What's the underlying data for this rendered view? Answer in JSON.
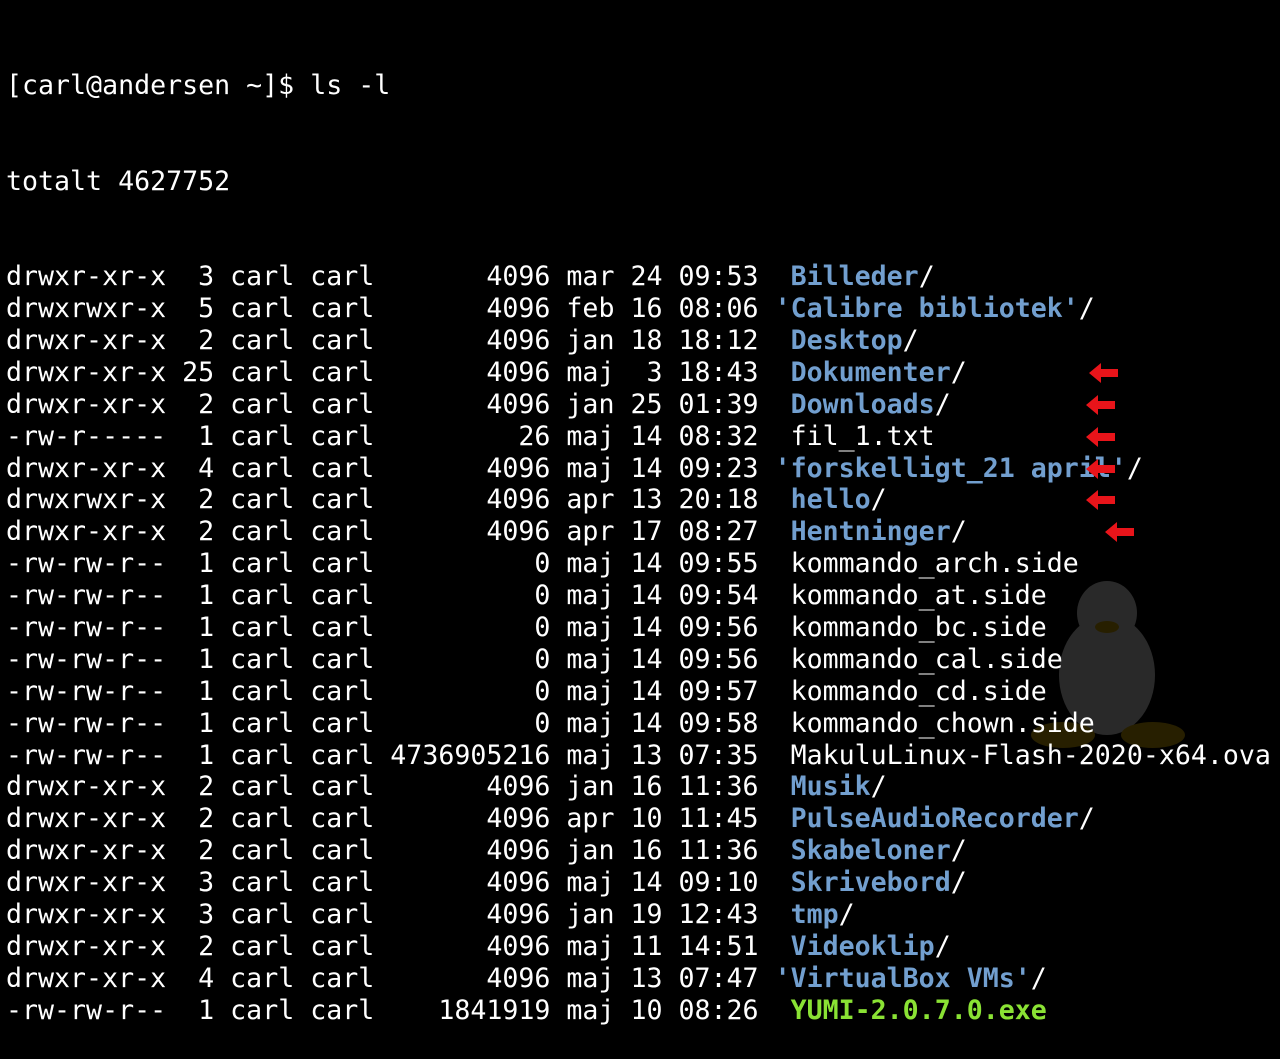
{
  "prompt": "[carl@andersen ~]$ ",
  "command": "ls -l",
  "total": "totalt 4627752",
  "colors": {
    "background": "#000000",
    "text": "#ffffff",
    "directory": "#729fcf",
    "executable": "#8ae234",
    "arrow": "#e8141a"
  },
  "entries": [
    {
      "perm": "drwxr-xr-x",
      "links": " 3",
      "owner": "carl",
      "group": "carl",
      "size": "      4096",
      "month": "mar",
      "day": "24",
      "time": "09:53",
      "lead": " ",
      "name": "Billeder",
      "quoted": false,
      "kind": "dir",
      "suffix": "/",
      "arrow": false
    },
    {
      "perm": "drwxrwxr-x",
      "links": " 5",
      "owner": "carl",
      "group": "carl",
      "size": "      4096",
      "month": "feb",
      "day": "16",
      "time": "08:06",
      "lead": "",
      "name": "Calibre bibliotek",
      "quoted": true,
      "kind": "dir",
      "suffix": "/",
      "arrow": false
    },
    {
      "perm": "drwxr-xr-x",
      "links": " 2",
      "owner": "carl",
      "group": "carl",
      "size": "      4096",
      "month": "jan",
      "day": "18",
      "time": "18:12",
      "lead": " ",
      "name": "Desktop",
      "quoted": false,
      "kind": "dir",
      "suffix": "/",
      "arrow": false
    },
    {
      "perm": "drwxr-xr-x",
      "links": "25",
      "owner": "carl",
      "group": "carl",
      "size": "      4096",
      "month": "maj",
      "day": " 3",
      "time": "18:43",
      "lead": " ",
      "name": "Dokumenter",
      "quoted": false,
      "kind": "dir",
      "suffix": "/",
      "arrow": false
    },
    {
      "perm": "drwxr-xr-x",
      "links": " 2",
      "owner": "carl",
      "group": "carl",
      "size": "      4096",
      "month": "jan",
      "day": "25",
      "time": "01:39",
      "lead": " ",
      "name": "Downloads",
      "quoted": false,
      "kind": "dir",
      "suffix": "/",
      "arrow": false
    },
    {
      "perm": "-rw-r-----",
      "links": " 1",
      "owner": "carl",
      "group": "carl",
      "size": "        26",
      "month": "maj",
      "day": "14",
      "time": "08:32",
      "lead": " ",
      "name": "fil_1.txt",
      "quoted": false,
      "kind": "file",
      "suffix": "",
      "arrow": false
    },
    {
      "perm": "drwxr-xr-x",
      "links": " 4",
      "owner": "carl",
      "group": "carl",
      "size": "      4096",
      "month": "maj",
      "day": "14",
      "time": "09:23",
      "lead": "",
      "name": "forskelligt_21 april",
      "quoted": true,
      "kind": "dir",
      "suffix": "/",
      "arrow": false
    },
    {
      "perm": "drwxrwxr-x",
      "links": " 2",
      "owner": "carl",
      "group": "carl",
      "size": "      4096",
      "month": "apr",
      "day": "13",
      "time": "20:18",
      "lead": " ",
      "name": "hello",
      "quoted": false,
      "kind": "dir",
      "suffix": "/",
      "arrow": false
    },
    {
      "perm": "drwxr-xr-x",
      "links": " 2",
      "owner": "carl",
      "group": "carl",
      "size": "      4096",
      "month": "apr",
      "day": "17",
      "time": "08:27",
      "lead": " ",
      "name": "Hentninger",
      "quoted": false,
      "kind": "dir",
      "suffix": "/",
      "arrow": false
    },
    {
      "perm": "-rw-rw-r--",
      "links": " 1",
      "owner": "carl",
      "group": "carl",
      "size": "         0",
      "month": "maj",
      "day": "14",
      "time": "09:55",
      "lead": " ",
      "name": "kommando_arch.side",
      "quoted": false,
      "kind": "file",
      "suffix": "",
      "arrow": true
    },
    {
      "perm": "-rw-rw-r--",
      "links": " 1",
      "owner": "carl",
      "group": "carl",
      "size": "         0",
      "month": "maj",
      "day": "14",
      "time": "09:54",
      "lead": " ",
      "name": "kommando_at.side",
      "quoted": false,
      "kind": "file",
      "suffix": "",
      "arrow": true
    },
    {
      "perm": "-rw-rw-r--",
      "links": " 1",
      "owner": "carl",
      "group": "carl",
      "size": "         0",
      "month": "maj",
      "day": "14",
      "time": "09:56",
      "lead": " ",
      "name": "kommando_bc.side",
      "quoted": false,
      "kind": "file",
      "suffix": "",
      "arrow": true
    },
    {
      "perm": "-rw-rw-r--",
      "links": " 1",
      "owner": "carl",
      "group": "carl",
      "size": "         0",
      "month": "maj",
      "day": "14",
      "time": "09:56",
      "lead": " ",
      "name": "kommando_cal.side",
      "quoted": false,
      "kind": "file",
      "suffix": "",
      "arrow": true
    },
    {
      "perm": "-rw-rw-r--",
      "links": " 1",
      "owner": "carl",
      "group": "carl",
      "size": "         0",
      "month": "maj",
      "day": "14",
      "time": "09:57",
      "lead": " ",
      "name": "kommando_cd.side",
      "quoted": false,
      "kind": "file",
      "suffix": "",
      "arrow": true
    },
    {
      "perm": "-rw-rw-r--",
      "links": " 1",
      "owner": "carl",
      "group": "carl",
      "size": "         0",
      "month": "maj",
      "day": "14",
      "time": "09:58",
      "lead": " ",
      "name": "kommando_chown.side",
      "quoted": false,
      "kind": "file",
      "suffix": "",
      "arrow": true
    },
    {
      "perm": "-rw-rw-r--",
      "links": " 1",
      "owner": "carl",
      "group": "carl",
      "size": "4736905216",
      "month": "maj",
      "day": "13",
      "time": "07:35",
      "lead": " ",
      "name": "MakuluLinux-Flash-2020-x64.ova",
      "quoted": false,
      "kind": "file",
      "suffix": "",
      "arrow": false
    },
    {
      "perm": "drwxr-xr-x",
      "links": " 2",
      "owner": "carl",
      "group": "carl",
      "size": "      4096",
      "month": "jan",
      "day": "16",
      "time": "11:36",
      "lead": " ",
      "name": "Musik",
      "quoted": false,
      "kind": "dir",
      "suffix": "/",
      "arrow": false
    },
    {
      "perm": "drwxr-xr-x",
      "links": " 2",
      "owner": "carl",
      "group": "carl",
      "size": "      4096",
      "month": "apr",
      "day": "10",
      "time": "11:45",
      "lead": " ",
      "name": "PulseAudioRecorder",
      "quoted": false,
      "kind": "dir",
      "suffix": "/",
      "arrow": false
    },
    {
      "perm": "drwxr-xr-x",
      "links": " 2",
      "owner": "carl",
      "group": "carl",
      "size": "      4096",
      "month": "jan",
      "day": "16",
      "time": "11:36",
      "lead": " ",
      "name": "Skabeloner",
      "quoted": false,
      "kind": "dir",
      "suffix": "/",
      "arrow": false
    },
    {
      "perm": "drwxr-xr-x",
      "links": " 3",
      "owner": "carl",
      "group": "carl",
      "size": "      4096",
      "month": "maj",
      "day": "14",
      "time": "09:10",
      "lead": " ",
      "name": "Skrivebord",
      "quoted": false,
      "kind": "dir",
      "suffix": "/",
      "arrow": false
    },
    {
      "perm": "drwxr-xr-x",
      "links": " 3",
      "owner": "carl",
      "group": "carl",
      "size": "      4096",
      "month": "jan",
      "day": "19",
      "time": "12:43",
      "lead": " ",
      "name": "tmp",
      "quoted": false,
      "kind": "dir",
      "suffix": "/",
      "arrow": false
    },
    {
      "perm": "drwxr-xr-x",
      "links": " 2",
      "owner": "carl",
      "group": "carl",
      "size": "      4096",
      "month": "maj",
      "day": "11",
      "time": "14:51",
      "lead": " ",
      "name": "Videoklip",
      "quoted": false,
      "kind": "dir",
      "suffix": "/",
      "arrow": false
    },
    {
      "perm": "drwxr-xr-x",
      "links": " 4",
      "owner": "carl",
      "group": "carl",
      "size": "      4096",
      "month": "maj",
      "day": "13",
      "time": "07:47",
      "lead": "",
      "name": "VirtualBox VMs",
      "quoted": true,
      "kind": "dir",
      "suffix": "/",
      "arrow": false
    },
    {
      "perm": "-rw-rw-r--",
      "links": " 1",
      "owner": "carl",
      "group": "carl",
      "size": "   1841919",
      "month": "maj",
      "day": "10",
      "time": "08:26",
      "lead": " ",
      "name": "YUMI-2.0.7.0.exe",
      "quoted": false,
      "kind": "exe",
      "suffix": "",
      "arrow": false
    }
  ]
}
